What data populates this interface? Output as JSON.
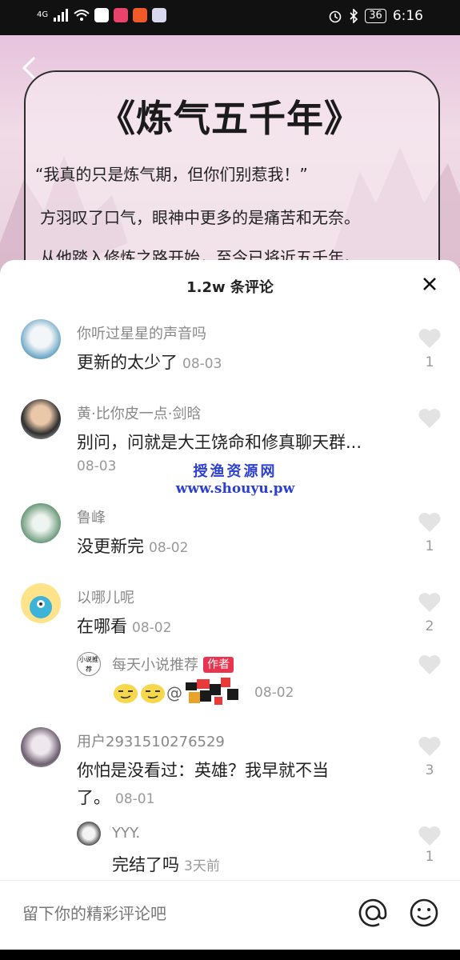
{
  "status_bar": {
    "signal": "4G",
    "battery": "36",
    "time": "6:16"
  },
  "cover": {
    "book_title": "《炼气五千年》",
    "lines": [
      "“我真的只是炼气期，但你们别惹我！”",
      "方羽叹了口气，眼神中更多的是痛苦和无奈。",
      "从他踏入修炼之路开始，至今已将近五千年。"
    ]
  },
  "sheet": {
    "title": "1.2w 条评论"
  },
  "comments": [
    {
      "user": "你听过星星的声音吗",
      "text": "更新的太少了",
      "date": "08-03",
      "likes": "1"
    },
    {
      "user": "黄·比你皮一点·剑晗",
      "text": "别问，问就是大王饶命和修真聊天群...",
      "date": "08-03",
      "likes": ""
    },
    {
      "user": "鲁峰",
      "text": "没更新完",
      "date": "08-02",
      "likes": "1"
    },
    {
      "user": "以哪儿呢",
      "text": "在哪看",
      "date": "08-02",
      "likes": "2"
    },
    {
      "user": "每天小说推荐",
      "badge": "作者",
      "text": "",
      "date": "08-02",
      "likes": "",
      "avatar_text": "小说推荐"
    },
    {
      "user": "用户2931510276529",
      "text": "你怕是没看过：英雄？我早就不当",
      "text2": "了。",
      "date": "08-01",
      "likes": "3"
    },
    {
      "user": "YYY.",
      "text": "完结了吗",
      "date": "3天前",
      "likes": "1"
    }
  ],
  "watermark": {
    "line1": "授渔资源网",
    "line2": "www.shouyu.pw"
  },
  "input": {
    "placeholder": "留下你的精彩评论吧"
  },
  "colors": {
    "badge": "#e8344e",
    "watermark": "#2b3fd1"
  }
}
